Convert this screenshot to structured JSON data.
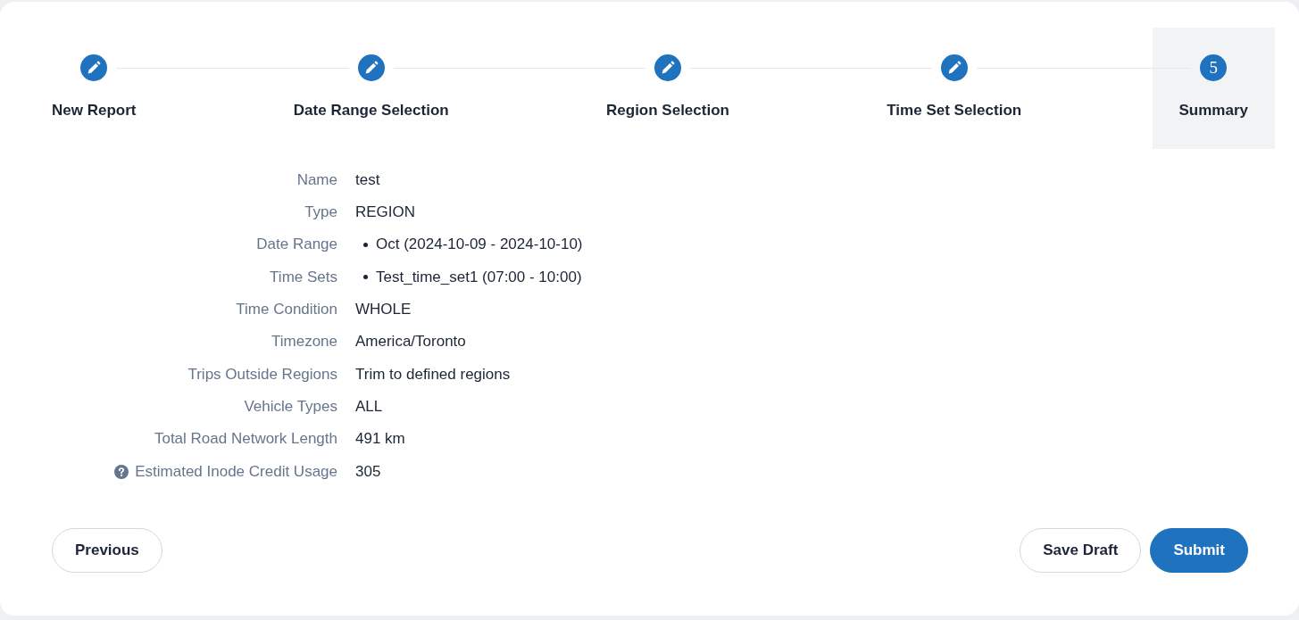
{
  "steps": [
    {
      "label": "New Report",
      "completed": true,
      "selected": false
    },
    {
      "label": "Date Range Selection",
      "completed": true,
      "selected": false
    },
    {
      "label": "Region Selection",
      "completed": true,
      "selected": false
    },
    {
      "label": "Time Set Selection",
      "completed": true,
      "selected": false
    },
    {
      "label": "Summary",
      "number": "5",
      "completed": false,
      "selected": true
    }
  ],
  "summary": [
    {
      "label": "Name",
      "kind": "text",
      "value": "test",
      "help": false
    },
    {
      "label": "Type",
      "kind": "text",
      "value": "REGION",
      "help": false
    },
    {
      "label": "Date Range",
      "kind": "list",
      "items": [
        "Oct (2024-10-09 - 2024-10-10)"
      ],
      "help": false
    },
    {
      "label": "Time Sets",
      "kind": "list",
      "items": [
        "Test_time_set1 (07:00 - 10:00)"
      ],
      "help": false
    },
    {
      "label": "Time Condition",
      "kind": "text",
      "value": "WHOLE",
      "help": false
    },
    {
      "label": "Timezone",
      "kind": "text",
      "value": "America/Toronto",
      "help": false
    },
    {
      "label": "Trips Outside Regions",
      "kind": "text",
      "value": "Trim to defined regions",
      "help": false
    },
    {
      "label": "Vehicle Types",
      "kind": "text",
      "value": "ALL",
      "help": false
    },
    {
      "label": "Total Road Network Length",
      "kind": "text",
      "value": "491 km",
      "help": false
    },
    {
      "label": "Estimated Inode Credit Usage",
      "kind": "text",
      "value": "305",
      "help": true
    }
  ],
  "footer": {
    "left": [
      {
        "label": "Previous",
        "kind": "secondary"
      }
    ],
    "right": [
      {
        "label": "Save Draft",
        "kind": "secondary"
      },
      {
        "label": "Submit",
        "kind": "primary"
      }
    ]
  }
}
